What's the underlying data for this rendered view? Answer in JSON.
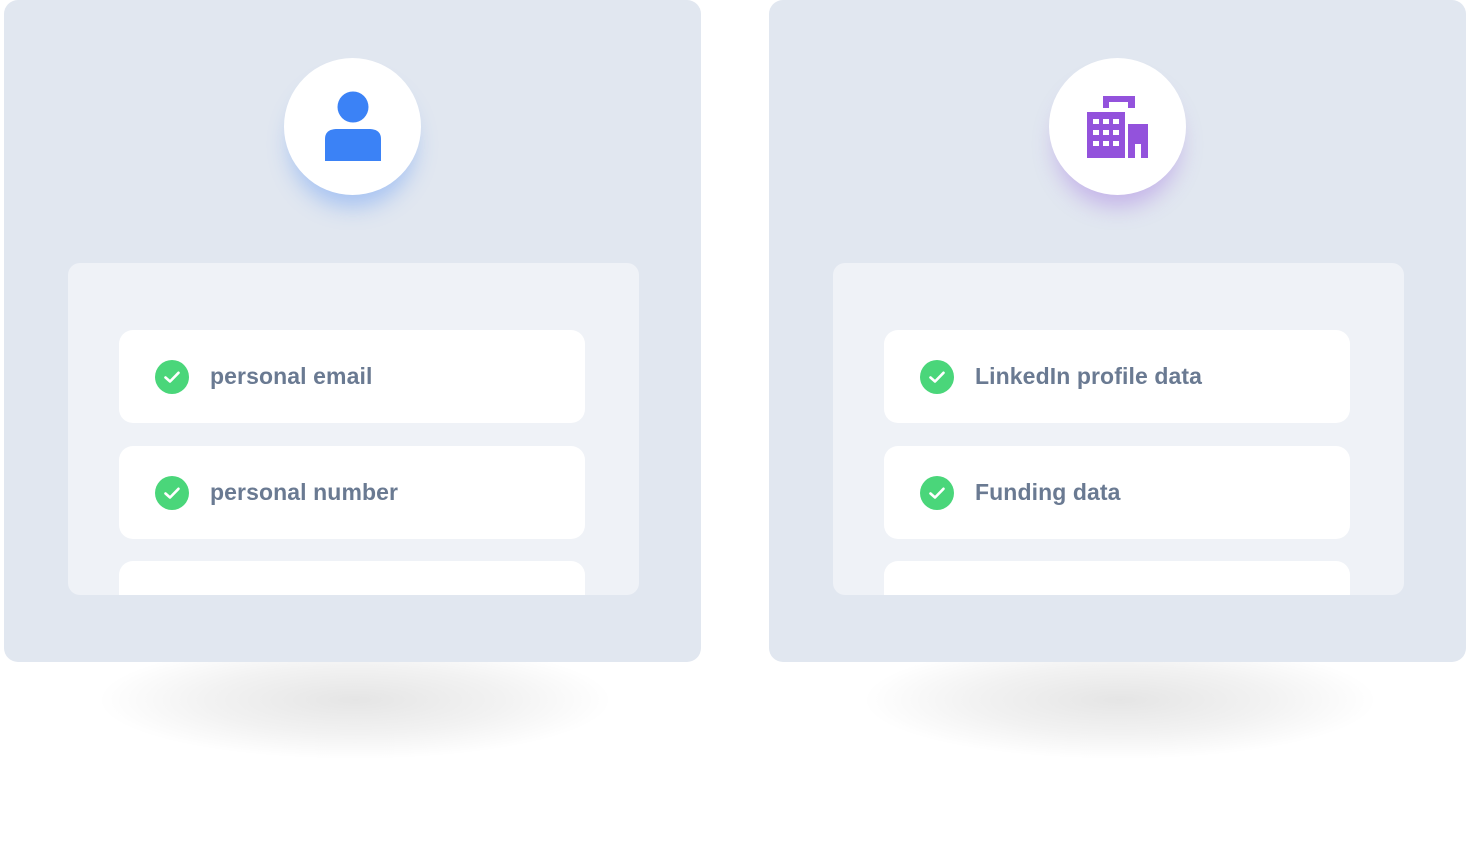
{
  "cards": [
    {
      "icon": "person-icon",
      "accent_color": "#3b82f6",
      "items": [
        {
          "label": "personal email",
          "checked": true
        },
        {
          "label": "personal number",
          "checked": true
        },
        {
          "label": "",
          "checked": false
        }
      ]
    },
    {
      "icon": "building-icon",
      "accent_color": "#9352dc",
      "items": [
        {
          "label": "LinkedIn profile data",
          "checked": true
        },
        {
          "label": "Funding data",
          "checked": true
        },
        {
          "label": "",
          "checked": false
        }
      ]
    }
  ],
  "check_color": "#4ad67a"
}
